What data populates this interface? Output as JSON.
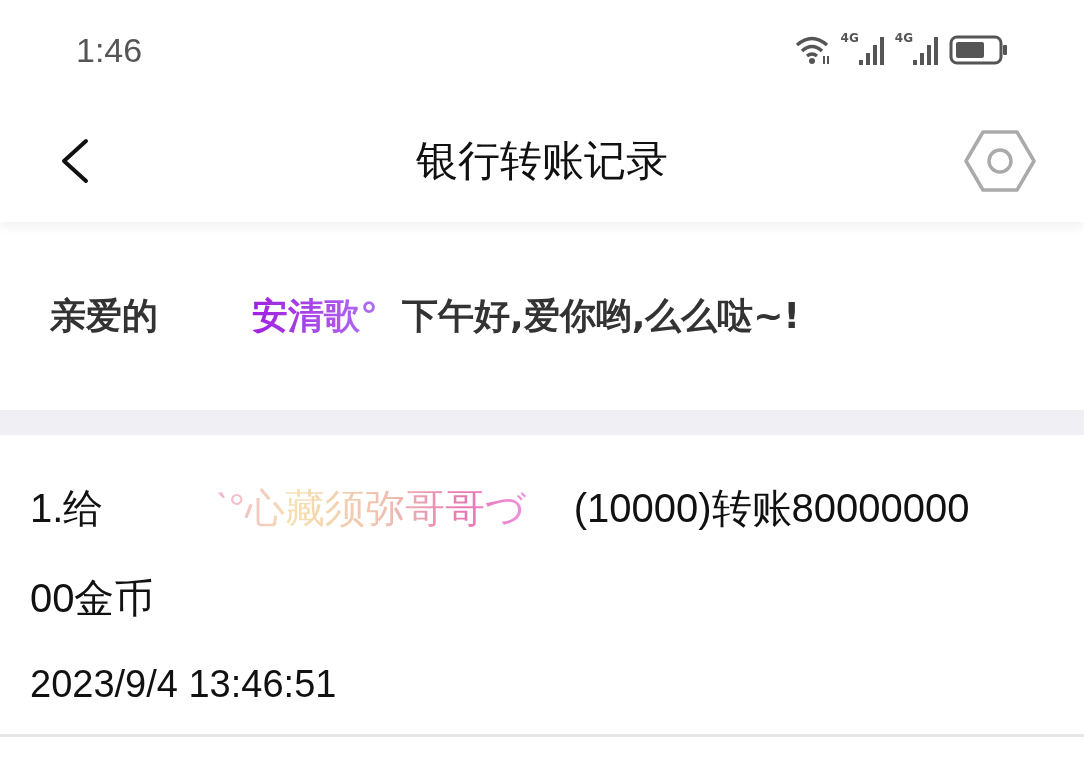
{
  "status_bar": {
    "time": "1:46",
    "network_labels": [
      "4G",
      "4G"
    ]
  },
  "header": {
    "title": "银行转账记录"
  },
  "greeting": {
    "salutation": "亲爱的",
    "name": "安清歌°",
    "message": "下午好,爱你哟,么么哒~!"
  },
  "records": [
    {
      "prefix": "1.给",
      "name": "ˋ°心藏须弥哥哥づ",
      "detail": "(10000)转账8000000000金币",
      "time": "2023/9/4 13:46:51"
    }
  ]
}
